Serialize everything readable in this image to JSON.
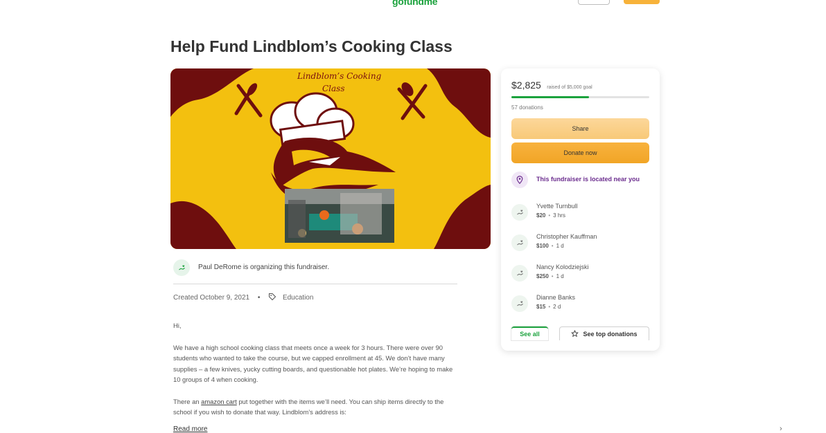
{
  "header": {
    "logo_text": "gofundme"
  },
  "campaign": {
    "title": "Help Fund Lindblom’s Cooking Class",
    "image_caption_line1": "Lindblom’s Cooking",
    "image_caption_line2": "Class",
    "organizer_text": "Paul DeRome is organizing this fundraiser.",
    "created": "Created October 9, 2021",
    "category": "Education",
    "story": {
      "greeting": "Hi,",
      "paragraph1": "We have a high school cooking class that meets once a week for 3 hours. There were over 90 students who wanted to take the course, but we capped enrollment at 45. We don’t have many supplies – a few knives, yucky cutting boards, and questionable hot plates. We’re hoping to make 10 groups of 4 when cooking.",
      "paragraph2_before_link": "There an ",
      "paragraph2_link": "amazon cart",
      "paragraph2_after_link": " put together with the items we’ll need. You can ship items directly to the school if you wish to donate that way. Lindblom’s address is:"
    },
    "read_more_label": "Read more"
  },
  "sidebar": {
    "raised_amount": "$2,825",
    "goal_text": "raised of $5,000 goal",
    "progress_fraction": 0.565,
    "donation_count": "57 donations",
    "share_label": "Share",
    "donate_label": "Donate now",
    "nearby_text": "This fundraiser is located near you",
    "donors": [
      {
        "name": "Yvette Turnbull",
        "amount": "$20",
        "time": "3 hrs"
      },
      {
        "name": "Christopher Kauffman",
        "amount": "$100",
        "time": "1 d"
      },
      {
        "name": "Nancy Kolodziejski",
        "amount": "$250",
        "time": "1 d"
      },
      {
        "name": "Dianne Banks",
        "amount": "$15",
        "time": "2 d"
      }
    ],
    "see_all_label": "See all",
    "top_donations_label": "See top donations"
  },
  "colors": {
    "brand_green": "#1ba23d",
    "donate_orange": "#f1a526",
    "share_orange": "#f8c978",
    "nearby_purple": "#6b2d8e",
    "hero_yellow": "#f3c00f",
    "hero_maroon": "#6e0e0e"
  },
  "icons": [
    "heart-hand-icon",
    "tag-icon",
    "map-pin-icon",
    "star-icon",
    "chevron-right-icon"
  ]
}
